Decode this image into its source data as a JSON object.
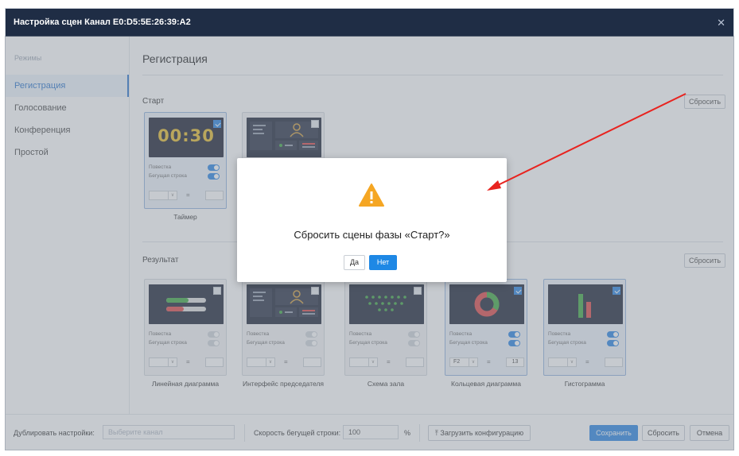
{
  "window": {
    "title": "Настройка сцен Канал E0:D5:5E:26:39:A2",
    "close_glyph": "✕"
  },
  "sidebar": {
    "header": "Режимы",
    "items": [
      {
        "label": "Регистрация"
      },
      {
        "label": "Голосование"
      },
      {
        "label": "Конференция"
      },
      {
        "label": "Простой"
      }
    ]
  },
  "main": {
    "title": "Регистрация",
    "start": {
      "label": "Старт",
      "reset": "Сбросить",
      "timer_text": "00:30",
      "cards": [
        {
          "caption": "Таймер",
          "checked": true,
          "opt1": "Повестка",
          "opt2": "Бегущая строка",
          "t1": true,
          "t2": true
        },
        {
          "caption": "",
          "checked": false
        }
      ]
    },
    "result": {
      "label": "Результат",
      "reset": "Сбросить",
      "cards": [
        {
          "caption": "Линейная диаграмма",
          "checked": false,
          "opt1": "Повестка",
          "opt2": "Бегущая строка",
          "t1": false,
          "t2": false,
          "sel": "",
          "num": ""
        },
        {
          "caption": "Интерфейс председателя",
          "checked": false,
          "opt1": "Повестка",
          "opt2": "Бегущая строка",
          "t1": false,
          "t2": false,
          "sel": "",
          "num": ""
        },
        {
          "caption": "Схема зала",
          "checked": false,
          "opt1": "Повестка",
          "opt2": "Бегущая строка",
          "t1": false,
          "t2": false,
          "sel": "",
          "num": ""
        },
        {
          "caption": "Кольцевая диаграмма",
          "checked": true,
          "opt1": "Повестка",
          "opt2": "Бегущая строка",
          "t1": true,
          "t2": true,
          "sel": "F2",
          "num": "13"
        },
        {
          "caption": "Гистограмма",
          "checked": true,
          "opt1": "Повестка",
          "opt2": "Бегущая строка",
          "t1": true,
          "t2": true,
          "sel": "",
          "num": ""
        }
      ]
    }
  },
  "bottom": {
    "duplicate_label": "Дублировать настройки:",
    "channel_placeholder": "Выберите канал",
    "speed_label": "Скорость бегущей строки:",
    "speed_value": "100",
    "speed_unit": "%",
    "load_config": "Загрузить конфигурацию",
    "save": "Сохранить",
    "reset": "Сбросить",
    "cancel": "Отмена"
  },
  "dialog": {
    "message": "Сбросить сцены фазы «Старт?»",
    "yes": "Да",
    "no": "Нет"
  },
  "colors": {
    "accent": "#3a8ee6",
    "titlebar": "#1f2d45",
    "warning": "#f5a623",
    "arrow": "#e8231f"
  }
}
